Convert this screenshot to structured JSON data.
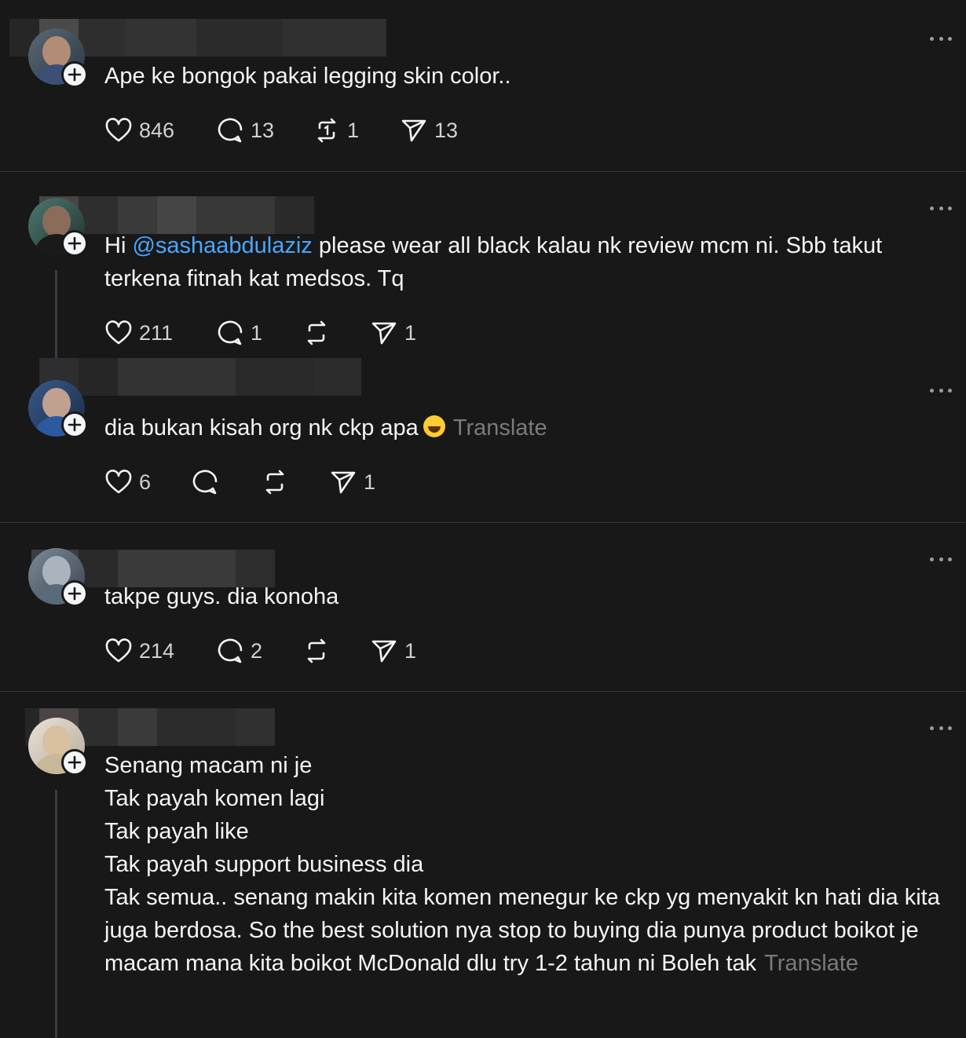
{
  "colors": {
    "background": "#181818",
    "text": "#f3f5f7",
    "mention": "#4aa6ff",
    "muted": "#7a7a7a",
    "divider": "#333638"
  },
  "icons": {
    "like": "heart-icon",
    "reply": "comment-icon",
    "repost": "repost-icon",
    "share": "send-icon",
    "more": "more-dots-icon",
    "follow": "plus-icon"
  },
  "posts": [
    {
      "text": "Ape ke bongok pakai legging skin color..",
      "likes": "846",
      "replies": "13",
      "reposts": "1",
      "shares": "13"
    },
    {
      "mention": "@sashaabdulaziz",
      "text_before": "Hi ",
      "text_after": " please wear all black kalau nk review mcm ni. Sbb takut terkena fitnah kat medsos. Tq",
      "likes": "211",
      "replies": "1",
      "reposts": "",
      "shares": "1"
    },
    {
      "text": "dia bukan kisah org nk ckp apa",
      "translate": "Translate",
      "likes": "6",
      "replies": "",
      "reposts": "",
      "shares": "1"
    },
    {
      "text": "takpe guys. dia konoha",
      "likes": "214",
      "replies": "2",
      "reposts": "",
      "shares": "1"
    },
    {
      "text": "Senang macam ni je\nTak payah komen lagi\nTak payah like\nTak payah support business dia\nTak semua.. senang makin kita komen menegur ke ckp yg menyakit kn hati dia kita juga berdosa. So the best solution nya stop to buying dia punya product boikot je macam mana kita boikot McDonald dlu try 1-2 tahun ni Boleh tak",
      "translate": "Translate"
    }
  ]
}
